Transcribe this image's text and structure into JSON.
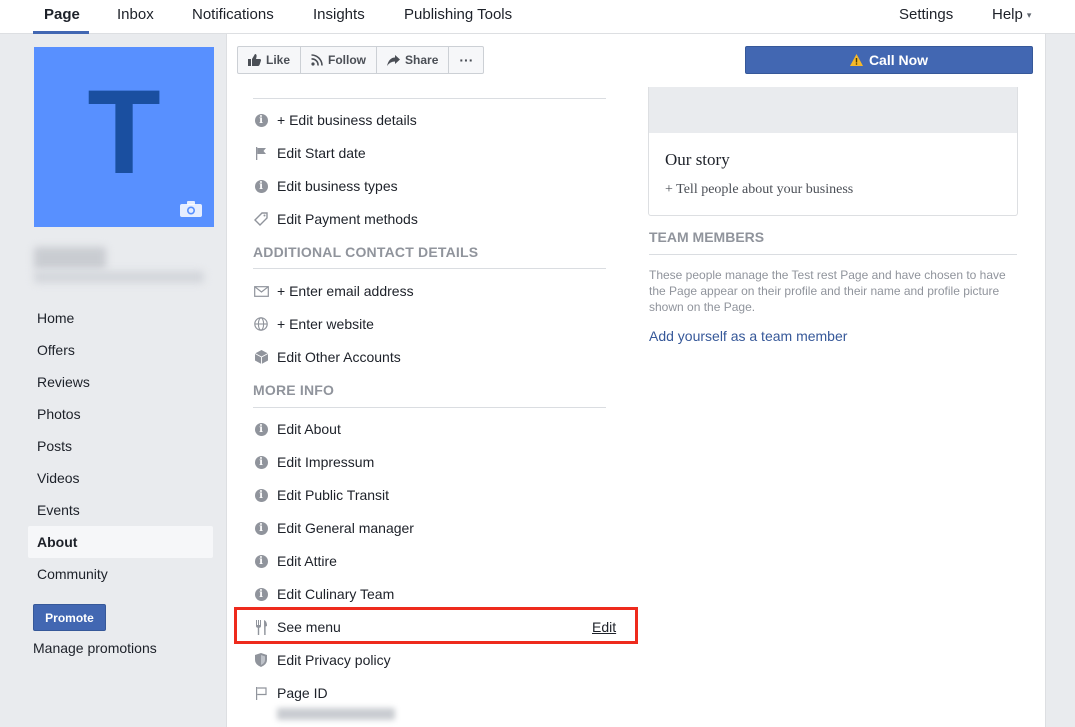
{
  "topnav": {
    "tabs": [
      "Page",
      "Inbox",
      "Notifications",
      "Insights",
      "Publishing Tools"
    ],
    "settings": "Settings",
    "help": "Help",
    "help_caret": "▾"
  },
  "cover": {
    "letter": "T"
  },
  "leftnav": {
    "items": [
      "Home",
      "Offers",
      "Reviews",
      "Photos",
      "Posts",
      "Videos",
      "Events",
      "About",
      "Community"
    ],
    "promote": "Promote",
    "manage": "Manage promotions"
  },
  "actions": {
    "like": "Like",
    "follow": "Follow",
    "share": "Share",
    "more": "···",
    "call_now": "Call Now"
  },
  "about": {
    "business": [
      "+ Edit business details",
      "Edit Start date",
      "Edit business types",
      "Edit Payment methods"
    ],
    "contact_title": "ADDITIONAL CONTACT DETAILS",
    "contact": [
      "+ Enter email address",
      "+ Enter website",
      "Edit Other Accounts"
    ],
    "more_title": "MORE INFO",
    "more": [
      "Edit About",
      "Edit Impressum",
      "Edit Public Transit",
      "Edit General manager",
      "Edit Attire",
      "Edit Culinary Team"
    ],
    "see_menu": "See menu",
    "see_menu_edit": "Edit",
    "privacy": "Edit Privacy policy",
    "page_id": "Page ID"
  },
  "story": {
    "title": "Our story",
    "subtitle": "+ Tell people about your business"
  },
  "team": {
    "title": "TEAM MEMBERS",
    "description": "These people manage the Test rest Page and have chosen to have the Page appear on their profile and their name and profile picture shown on the Page.",
    "add": "Add yourself as a team member"
  },
  "colors": {
    "brand": "#4267b2",
    "highlight": "#ee2a1d",
    "cover": "#5890ff"
  }
}
